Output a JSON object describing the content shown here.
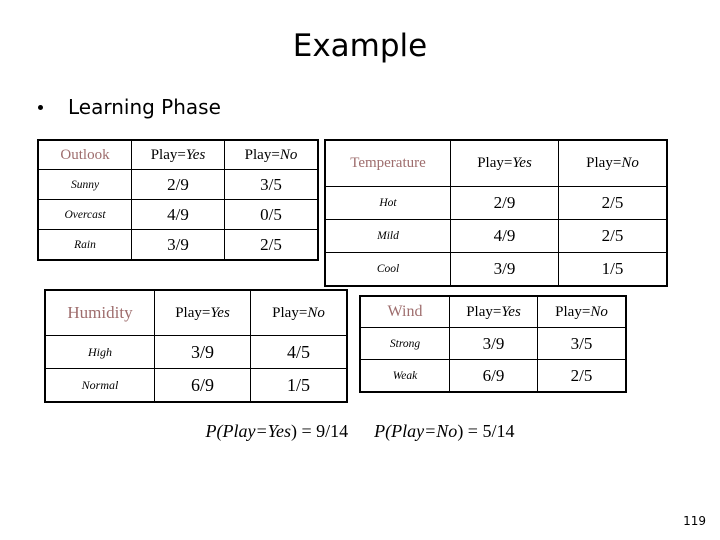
{
  "slide": {
    "title": "Example",
    "page_number": "119",
    "header_color": "#9E6D6D"
  },
  "bullet": {
    "label": "Learning Phase"
  },
  "common": {
    "play_yes_prefix": "Play=",
    "play_yes_value": "Yes",
    "play_no_prefix": "Play=",
    "play_no_value": "No"
  },
  "tables": {
    "outlook": {
      "attribute": "Outlook",
      "col_yes": "Play=Yes",
      "col_no": "Play=No",
      "rows": [
        {
          "label": "Sunny",
          "yes": "2/9",
          "no": "3/5"
        },
        {
          "label": "Overcast",
          "yes": "4/9",
          "no": "0/5"
        },
        {
          "label": "Rain",
          "yes": "3/9",
          "no": "2/5"
        }
      ]
    },
    "temperature": {
      "attribute": "Temperature",
      "col_yes": "Play=Yes",
      "col_no": "Play=No",
      "rows": [
        {
          "label": "Hot",
          "yes": "2/9",
          "no": "2/5"
        },
        {
          "label": "Mild",
          "yes": "4/9",
          "no": "2/5"
        },
        {
          "label": "Cool",
          "yes": "3/9",
          "no": "1/5"
        }
      ]
    },
    "humidity": {
      "attribute": "Humidity",
      "col_yes": "Play=Yes",
      "col_no": "Play=No",
      "rows": [
        {
          "label": "High",
          "yes": "3/9",
          "no": "4/5"
        },
        {
          "label": "Normal",
          "yes": "6/9",
          "no": "1/5"
        }
      ]
    },
    "wind": {
      "attribute": "Wind",
      "col_yes": "Play=Yes",
      "col_no": "Play=No",
      "rows": [
        {
          "label": "Strong",
          "yes": "3/9",
          "no": "3/5"
        },
        {
          "label": "Weak",
          "yes": "6/9",
          "no": "2/5"
        }
      ]
    }
  },
  "priors": {
    "yes": {
      "prefix": "P(Play=",
      "class": "Yes",
      "suffix": ") = 9/14"
    },
    "no": {
      "prefix": "P(Play=",
      "class": "No",
      "suffix": ") = 5/14"
    }
  }
}
